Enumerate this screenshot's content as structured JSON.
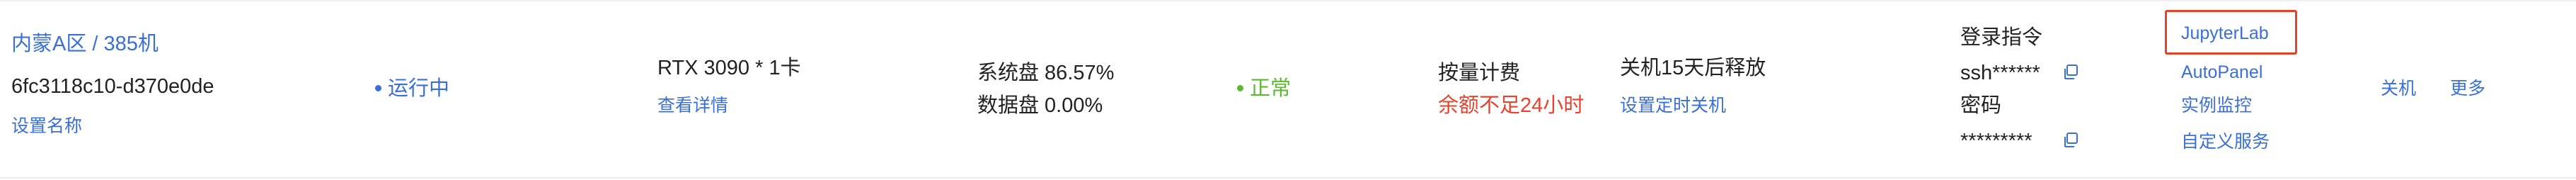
{
  "instance": {
    "region_label": "内蒙A区 / 385机",
    "id": "6fc3118c10-d370e0de",
    "set_name_label": "设置名称"
  },
  "status": {
    "label": "运行中"
  },
  "gpu": {
    "spec": "RTX 3090 * 1卡",
    "details_link": "查看详情"
  },
  "disk": {
    "system": "系统盘 86.57%",
    "data": "数据盘 0.00%"
  },
  "health": {
    "label": "正常"
  },
  "billing": {
    "mode": "按量计费",
    "warning": "余额不足24小时"
  },
  "release": {
    "text": "关机15天后释放",
    "schedule_link": "设置定时关机"
  },
  "login": {
    "command_label": "登录指令",
    "command_value": "ssh******",
    "password_label": "密码",
    "password_value": "*********"
  },
  "shortcuts": [
    "JupyterLab",
    "AutoPanel",
    "实例监控",
    "自定义服务"
  ],
  "actions": {
    "shutdown": "关机",
    "more": "更多"
  },
  "colors": {
    "link": "#3a6fd8",
    "status_running": "#3a6fd8",
    "health_ok": "#5cb82f",
    "warning": "#e5432f",
    "highlight_box": "#e0452b"
  },
  "icons": {
    "copy": "copy-icon",
    "status_dot": "status-dot-icon"
  }
}
